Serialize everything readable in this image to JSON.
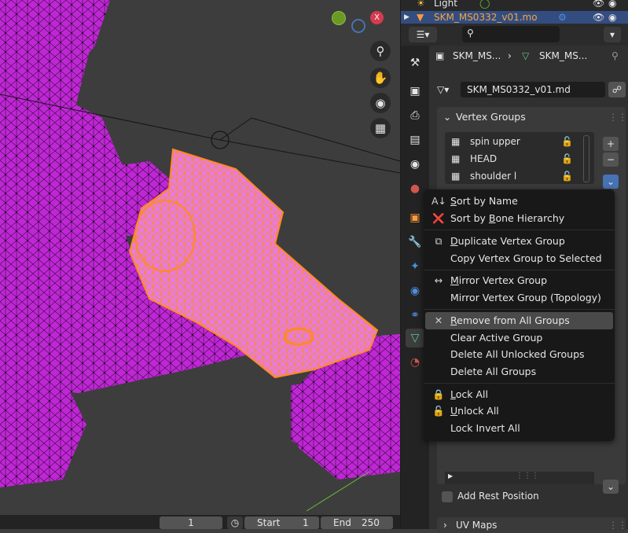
{
  "outliner": {
    "rows": [
      {
        "label": "Light"
      },
      {
        "label": "SKM_MS0332_v01.mo"
      }
    ]
  },
  "props_header": {
    "search_placeholder": ""
  },
  "breadcrumb": {
    "object": "SKM_MS...",
    "mesh": "SKM_MS..."
  },
  "mesh_name": "SKM_MS0332_v01.md",
  "vertex_groups_panel": {
    "title": "Vertex Groups",
    "items": [
      {
        "name": "spin upper"
      },
      {
        "name": "HEAD"
      },
      {
        "name": "shoulder l"
      }
    ]
  },
  "context_menu": {
    "items": [
      {
        "icon": "sort-alpha-icon",
        "label": "Sort by Name",
        "mnemonic": "S"
      },
      {
        "icon": "bone-icon",
        "label": "Sort by Bone Hierarchy",
        "mnemonic": "B"
      },
      {
        "icon": "duplicate-icon",
        "label": "Duplicate Vertex Group",
        "mnemonic": "D"
      },
      {
        "icon": "",
        "label": "Copy Vertex Group to Selected",
        "mnemonic": ""
      },
      {
        "icon": "mirror-icon",
        "label": "Mirror Vertex Group",
        "mnemonic": "M"
      },
      {
        "icon": "",
        "label": "Mirror Vertex Group (Topology)",
        "mnemonic": ""
      },
      {
        "icon": "x-icon",
        "label": "Remove from All Groups",
        "mnemonic": "R"
      },
      {
        "icon": "",
        "label": "Clear Active Group",
        "mnemonic": ""
      },
      {
        "icon": "",
        "label": "Delete All Unlocked Groups",
        "mnemonic": ""
      },
      {
        "icon": "",
        "label": "Delete All Groups",
        "mnemonic": ""
      },
      {
        "icon": "lock-icon",
        "label": "Lock All",
        "mnemonic": "L"
      },
      {
        "icon": "unlock-icon",
        "label": "Unlock All",
        "mnemonic": "U"
      },
      {
        "icon": "",
        "label": "Lock Invert All",
        "mnemonic": ""
      }
    ]
  },
  "add_rest_position": {
    "label": "Add Rest Position",
    "checked": false
  },
  "uv_maps": {
    "title": "UV Maps"
  },
  "timeline": {
    "current_frame": "1",
    "start_label": "Start",
    "start_value": "1",
    "end_label": "End",
    "end_value": "250"
  },
  "colors": {
    "mesh_magenta": "#c22bd6",
    "selected_orange": "#ff8a1f",
    "selected_face": "#e777e8",
    "accent_blue": "#4772b3"
  }
}
